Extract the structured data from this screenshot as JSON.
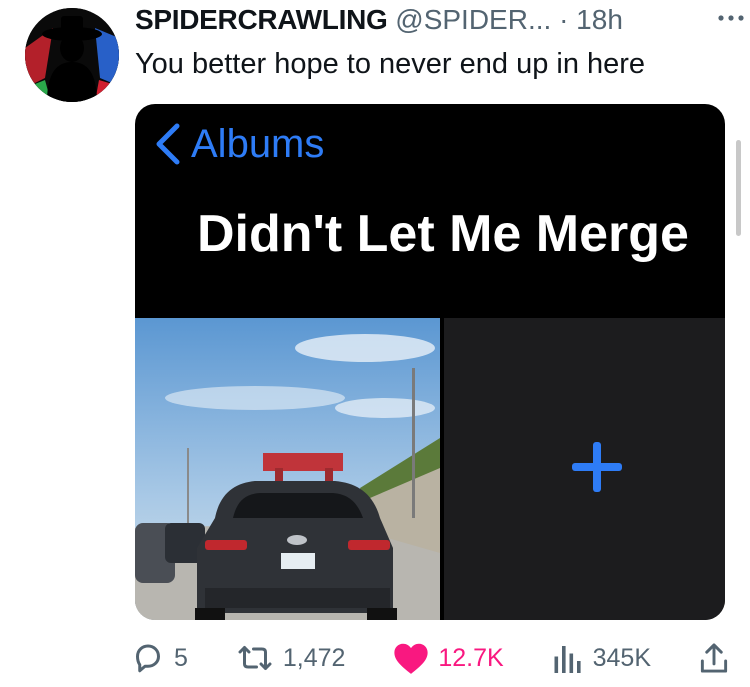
{
  "tweet": {
    "author_name": "SPIDERCRAWLING",
    "author_handle": "@SPIDER...",
    "separator": "·",
    "time": "18h",
    "text": "You better hope to never end up in here"
  },
  "media": {
    "back_label": "Albums",
    "album_title": "Didn't Let Me Merge"
  },
  "actions": {
    "replies": "5",
    "retweets": "1,472",
    "likes": "12.7K",
    "views": "345K"
  },
  "colors": {
    "ios_blue": "#2e7cf6",
    "like_pink": "#f91880",
    "muted": "#536471"
  }
}
